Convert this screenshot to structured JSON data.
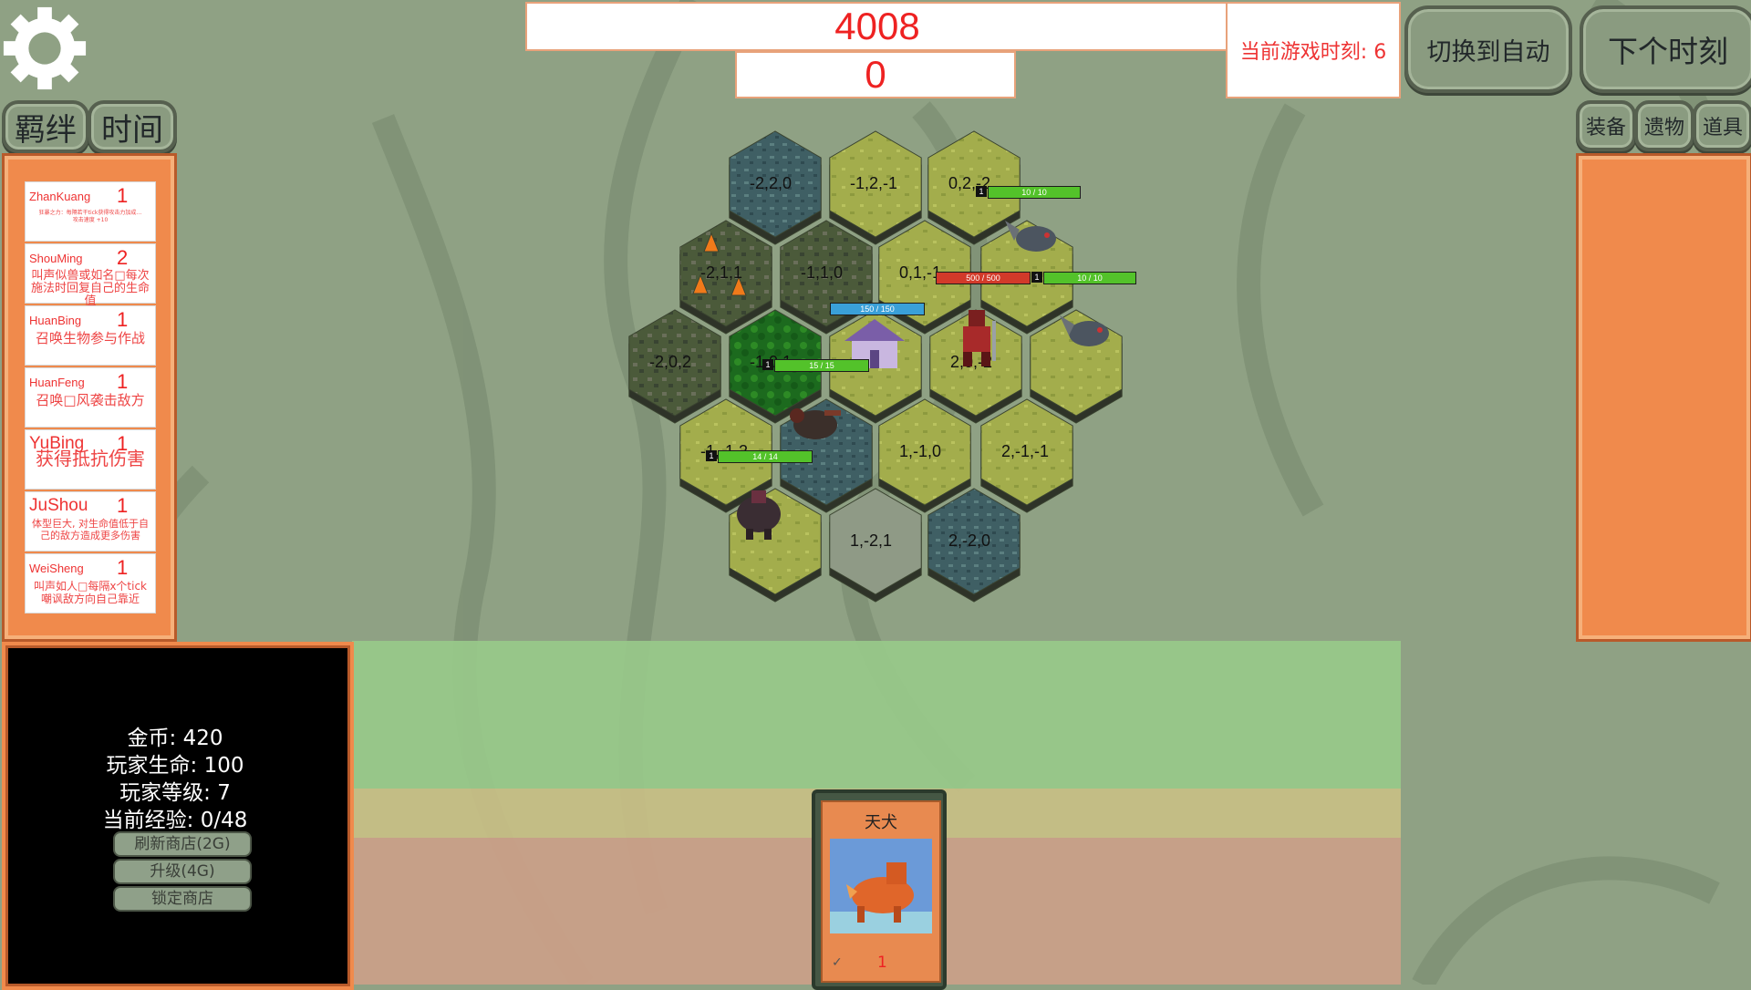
{
  "top": {
    "score": "4008",
    "sub_score": "0",
    "clock_label": "当前游戏时刻: 6",
    "auto_button": "切换到自动",
    "next_button": "下个时刻"
  },
  "left_tabs": {
    "bond": "羁绊",
    "time": "时间"
  },
  "right_tabs": {
    "equipment": "装备",
    "relic": "遗物",
    "item": "道具"
  },
  "synergies": [
    {
      "name": "ZhanKuang",
      "count": "1",
      "desc": "狂暴之力：每隔若干tick获得攻击力加成…",
      "desc2": "攻击速度 +10"
    },
    {
      "name": "ShouMing",
      "count": "2",
      "desc": "叫声似兽或如名□每次施法时回复自己的生命值"
    },
    {
      "name": "HuanBing",
      "count": "1",
      "desc": "召唤生物参与作战"
    },
    {
      "name": "HuanFeng",
      "count": "1",
      "desc": "召唤□风袭击敌方"
    },
    {
      "name": "YuBing",
      "count": "1",
      "desc": "获得抵抗伤害"
    },
    {
      "name": "JuShou",
      "count": "1",
      "desc": "体型巨大, 对生命值低于自己的敌方造成更多伤害"
    },
    {
      "name": "WeiSheng",
      "count": "1",
      "desc": "叫声如人□每隔x个tick嘲讽敌方向自己靠近"
    }
  ],
  "board": {
    "hexes": [
      {
        "label": "-2,2,0"
      },
      {
        "label": "-1,2,-1"
      },
      {
        "label": "0,2,-2"
      },
      {
        "label": "-2,1,1"
      },
      {
        "label": "-1,1,0"
      },
      {
        "label": "0,1,-1"
      },
      {
        "label": "-2,0,2"
      },
      {
        "label": "-1,0,1"
      },
      {
        "label": "2,0,-2"
      },
      {
        "label": "-1,-1,2"
      },
      {
        "label": "1,-1,0"
      },
      {
        "label": "2,-1,-1"
      },
      {
        "label": "1,-2,1"
      },
      {
        "label": "2,-2,0"
      }
    ],
    "units": [
      {
        "name": "fish-beast",
        "hp_text": "10 / 10",
        "hp": 1.0,
        "level": "1",
        "color": "#53c22a"
      },
      {
        "name": "fish-beast-2",
        "hp_text": "10 / 10",
        "hp": 1.0,
        "level": "1",
        "color": "#53c22a"
      },
      {
        "name": "red-warrior",
        "hp_text": "500 / 500",
        "hp": 1.0,
        "level": "",
        "color": "#d23a2a"
      },
      {
        "name": "purple-house",
        "hp_text": "150 / 150",
        "hp": 1.0,
        "level": "",
        "color": "#3aa0d8"
      },
      {
        "name": "bird",
        "hp_text": "15 / 15",
        "hp": 1.0,
        "level": "1",
        "color": "#53c22a"
      },
      {
        "name": "boar",
        "hp_text": "14 / 14",
        "hp": 1.0,
        "level": "1",
        "color": "#53c22a"
      }
    ]
  },
  "player": {
    "gold": "金币: 420",
    "life": "玩家生命: 100",
    "level": "玩家等级: 7",
    "exp": "当前经验: 0/48",
    "refresh_button": "刷新商店(2G)",
    "upgrade_button": "升级(4G)",
    "lock_button": "锁定商店"
  },
  "shop_card": {
    "name": "天犬",
    "cost": "1"
  },
  "colors": {
    "panel": "#f08a4c",
    "accent": "#ee2222",
    "grass": "#9fb04a"
  }
}
